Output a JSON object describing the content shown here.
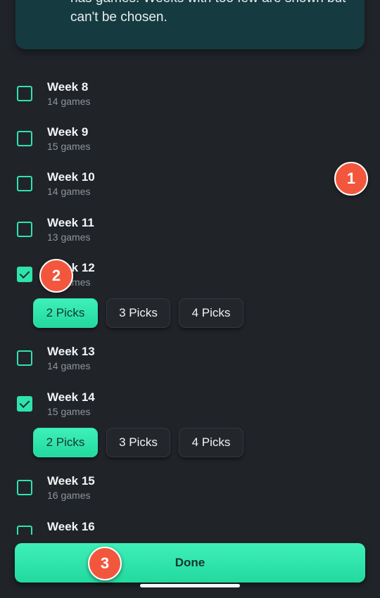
{
  "info": {
    "line1": "has games. Weeks with too few are shown but",
    "line2": "can't be chosen."
  },
  "weeks": [
    {
      "label": "Week 8",
      "games": "14 games",
      "checked": false
    },
    {
      "label": "Week 9",
      "games": "15 games",
      "checked": false
    },
    {
      "label": "Week 10",
      "games": "14 games",
      "checked": false
    },
    {
      "label": "Week 11",
      "games": "13 games",
      "checked": false
    },
    {
      "label": "Week 12",
      "games": "14 games",
      "checked": true
    },
    {
      "label": "Week 13",
      "games": "14 games",
      "checked": false
    },
    {
      "label": "Week 14",
      "games": "15 games",
      "checked": true
    },
    {
      "label": "Week 15",
      "games": "16 games",
      "checked": false
    },
    {
      "label": "Week 16",
      "games": "",
      "checked": false
    }
  ],
  "picks": {
    "options": [
      "2 Picks",
      "3 Picks",
      "4 Picks"
    ],
    "selected": "2 Picks"
  },
  "badges": [
    "1",
    "2",
    "3"
  ],
  "done_label": "Done",
  "colors": {
    "background": "#202429",
    "accent": "#2fe3ad",
    "badge": "#f2573e",
    "banner": "#153b40"
  }
}
